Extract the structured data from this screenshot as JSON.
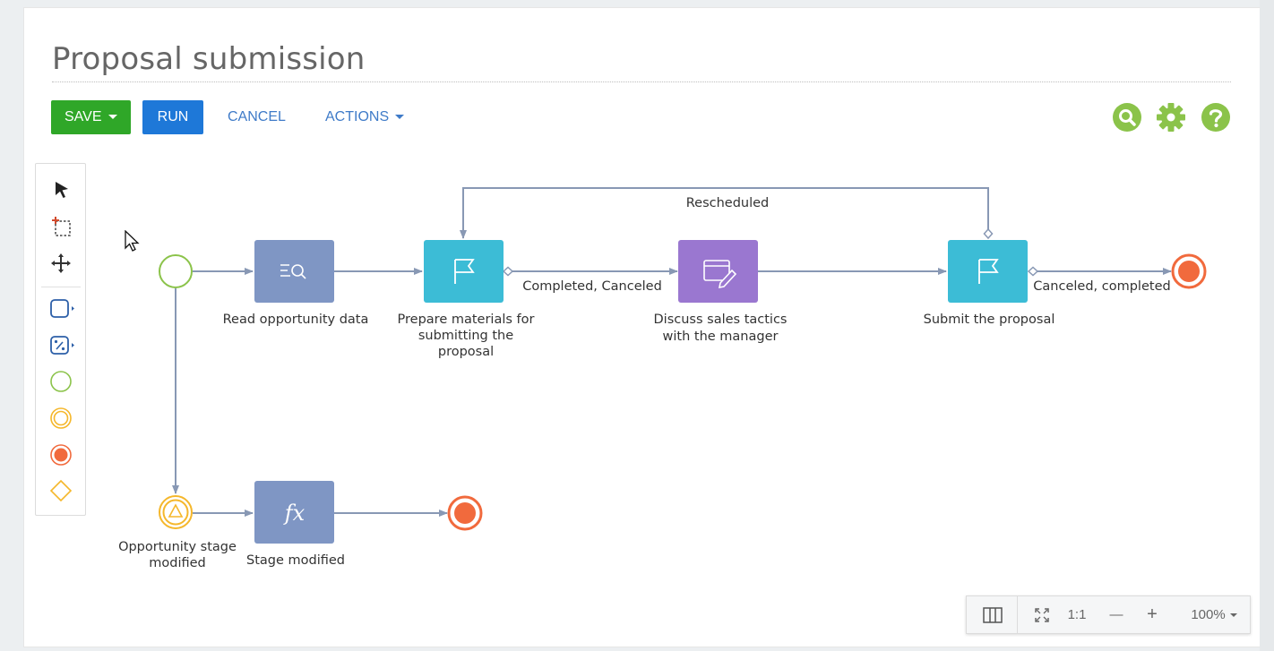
{
  "page": {
    "title": "Proposal submission"
  },
  "toolbar": {
    "save_label": "SAVE",
    "run_label": "RUN",
    "cancel_label": "CANCEL",
    "actions_label": "ACTIONS"
  },
  "top_icons": [
    "search-icon",
    "gear-icon",
    "help-icon"
  ],
  "palette": [
    "pointer-tool-icon",
    "lasso-select-icon",
    "pan-move-icon",
    "task-element-icon",
    "subprocess-element-icon",
    "start-event-icon",
    "intermediate-event-icon",
    "end-event-icon",
    "gateway-icon"
  ],
  "process": {
    "nodes": {
      "read_data": "Read opportunity data",
      "prepare_materials": [
        "Prepare materials for",
        "submitting the",
        "proposal"
      ],
      "discuss_tactics": [
        "Discuss sales tactics",
        "with the manager"
      ],
      "submit_proposal": "Submit the proposal",
      "stage_signal": [
        "Opportunity stage",
        "modified"
      ],
      "stage_formula": "Stage modified"
    },
    "flows": {
      "rescheduled": "Rescheduled",
      "completed_canceled": "Completed, Canceled",
      "canceled_completed": "Canceled, completed"
    }
  },
  "zoom": {
    "fit_label": "1:1",
    "minus_label": "—",
    "plus_label": "+",
    "level": "100%"
  },
  "colors": {
    "save": "#2fa728",
    "run": "#1e78d8",
    "link": "#3f7bc8",
    "icon_green": "#8bc34a",
    "read_task": "#7f96c4",
    "user_task": "#3cbcd6",
    "edit_task": "#9a77d0",
    "formula_task": "#7f96c4",
    "start": "#8bc34a",
    "end": "#f16a3d",
    "signal": "#f5b72b",
    "flow": "#8898b4"
  }
}
